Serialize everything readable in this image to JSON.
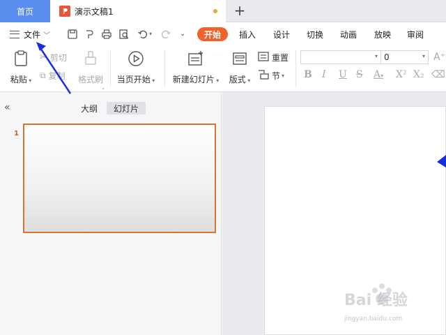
{
  "titlebar": {
    "home_tab": "首页",
    "doc_tab": "演示文稿1",
    "new_tab": "+"
  },
  "menu": {
    "file_label": "文件",
    "tabs": [
      {
        "label": "开始",
        "active": true
      },
      {
        "label": "插入",
        "active": false
      },
      {
        "label": "设计",
        "active": false
      },
      {
        "label": "切换",
        "active": false
      },
      {
        "label": "动画",
        "active": false
      },
      {
        "label": "放映",
        "active": false
      },
      {
        "label": "审阅",
        "active": false
      }
    ]
  },
  "ribbon": {
    "paste": "粘贴",
    "cut": "剪切",
    "copy": "复制",
    "format_painter": "格式刷",
    "play_from_current": "当页开始",
    "new_slide": "新建幻灯片",
    "layout": "版式",
    "reset": "重置",
    "section": "节",
    "font_size_value": "0",
    "font_name_value": ""
  },
  "left_pane": {
    "outline_tab": "大纲",
    "slides_tab": "幻灯片",
    "slide_number": "1"
  },
  "watermark": {
    "text": "Bai 经验",
    "url": "jingyan.baidu.com"
  },
  "colors": {
    "accent": "#f0622d",
    "home_tab": "#5b8def",
    "arrow": "#1a2ee0",
    "selection": "#d9742f"
  }
}
